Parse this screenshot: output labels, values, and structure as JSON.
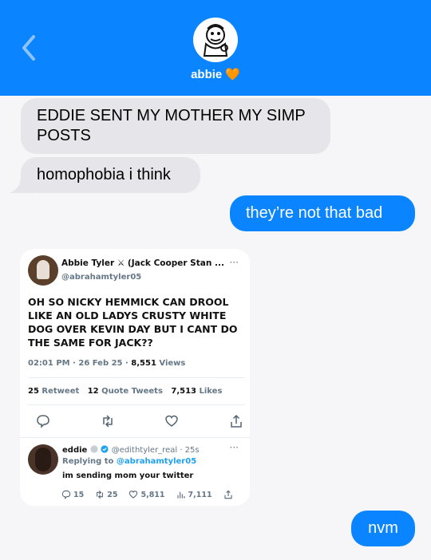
{
  "header": {
    "contact_name": "abbie",
    "contact_emoji": "🧡",
    "back_icon": "chevron-left-icon",
    "avatar_icon": "cartoon-avatar-icon"
  },
  "messages": [
    {
      "direction": "received",
      "text": "EDDIE SENT MY MOTHER MY SIMP POSTS"
    },
    {
      "direction": "received",
      "text": "homophobia i think"
    },
    {
      "direction": "sent",
      "text": "they’re not that bad"
    },
    {
      "direction": "sent",
      "text": "nvm"
    }
  ],
  "tweet": {
    "name": "Abbie Tyler ⚔ (Jack Cooper Stan ...",
    "handle": "@abrahamtyler05",
    "more": "···",
    "body": "OH SO NICKY HEMMICK CAN DROOL LIKE AN OLD LADYS CRUSTY WHITE DOG OVER KEVIN DAY BUT I CANT DO THE SAME FOR JACK??",
    "timestamp": "02:01 PM · 26 Feb 25 ·",
    "views_count": "8,551",
    "views_label": "Views",
    "retweets_count": "25",
    "retweets_label": "Retweet",
    "quotes_count": "12",
    "quotes_label": "Quote Tweets",
    "likes_count": "7,513",
    "likes_label": "Likes"
  },
  "reply": {
    "name": "eddie",
    "handle": "@edithtyler_real · 25s",
    "replying_prefix": "Replying to",
    "replying_to": "@abrahamtyler05",
    "text": "im sending mom your twitter",
    "more": "···",
    "replies": "15",
    "retweets": "25",
    "likes": "5,811",
    "views": "7,111"
  },
  "colors": {
    "header_bg": "#0a84ff",
    "sent_bubble": "#0a84ff",
    "received_bubble": "#e5e5ea",
    "twitter_blue": "#1da1f2"
  }
}
